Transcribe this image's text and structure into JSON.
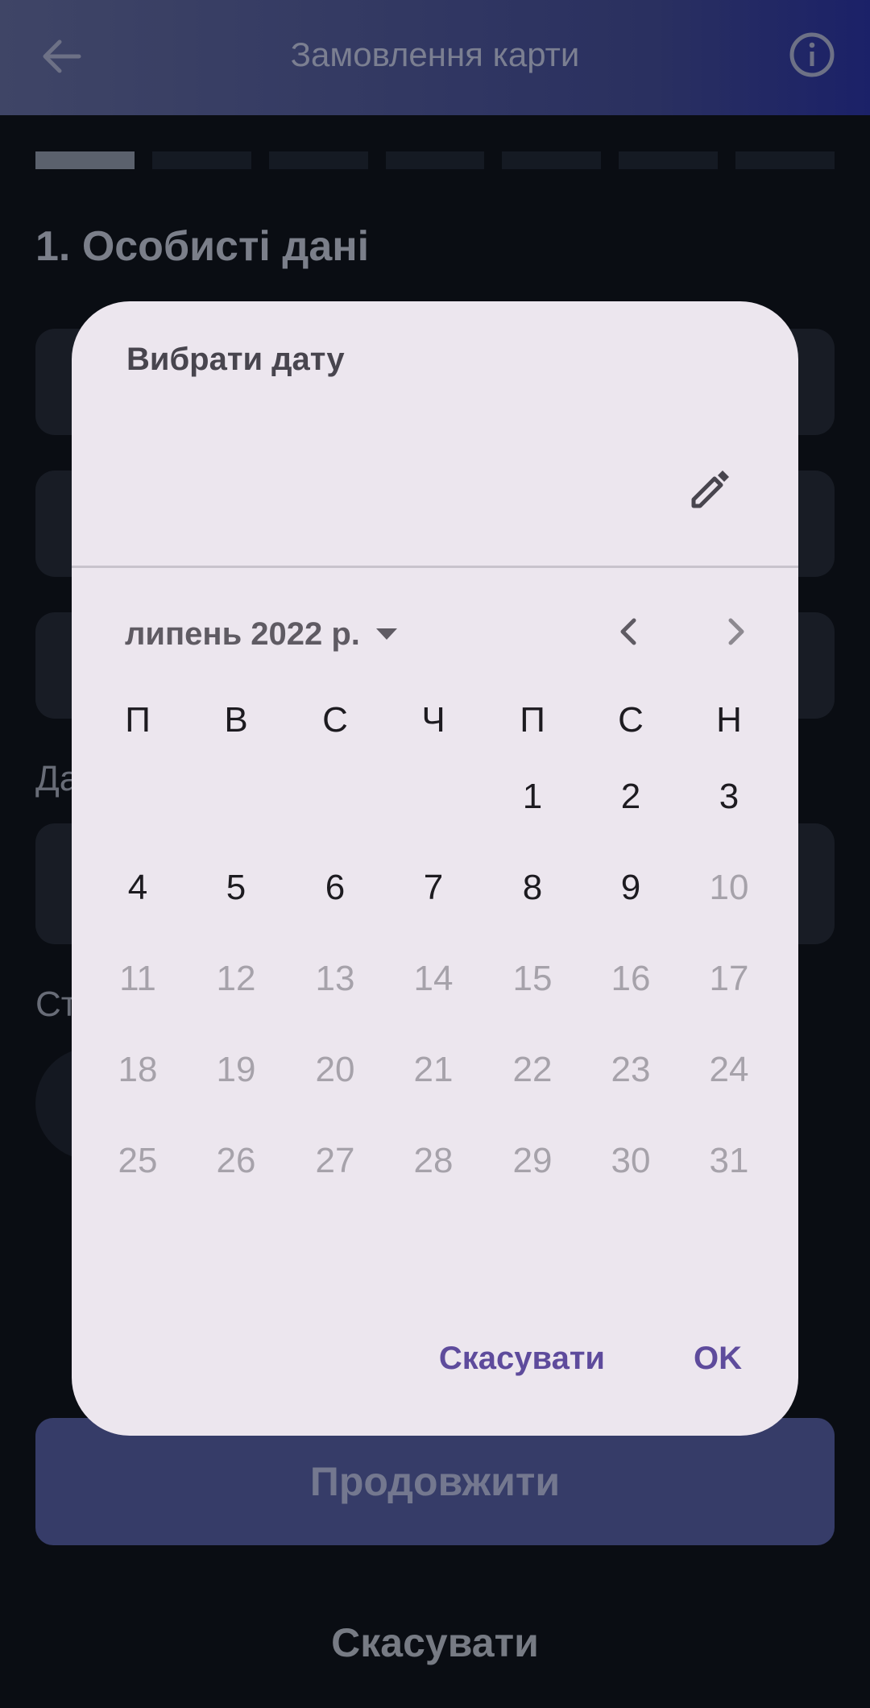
{
  "appbar": {
    "title": "Замовлення карти",
    "back_icon": "arrow-left-icon",
    "info_icon": "info-icon"
  },
  "progress": {
    "total_steps": 7,
    "current_step": 1
  },
  "form": {
    "section_title": "1. Особисті дані",
    "partial_label_1": "Да",
    "partial_label_2": "Ст"
  },
  "buttons": {
    "continue": "Продовжити",
    "cancel": "Скасувати"
  },
  "dialog": {
    "headline": "Вибрати дату",
    "month_label": "липень 2022 р.",
    "weekdays": [
      "П",
      "В",
      "С",
      "Ч",
      "П",
      "С",
      "Н"
    ],
    "first_weekday_index": 4,
    "days_in_month": 31,
    "last_enabled_day": 9,
    "cancel_label": "Скасувати",
    "ok_label": "OK",
    "icons": {
      "edit": "pencil-icon",
      "prev": "chevron-left-icon",
      "next": "chevron-right-icon",
      "month_dropdown": "caret-down-icon"
    }
  },
  "colors": {
    "accent": "#5e4b9c",
    "dialog_bg": "#ece6ee",
    "disabled_day": "#a6a2aa"
  }
}
